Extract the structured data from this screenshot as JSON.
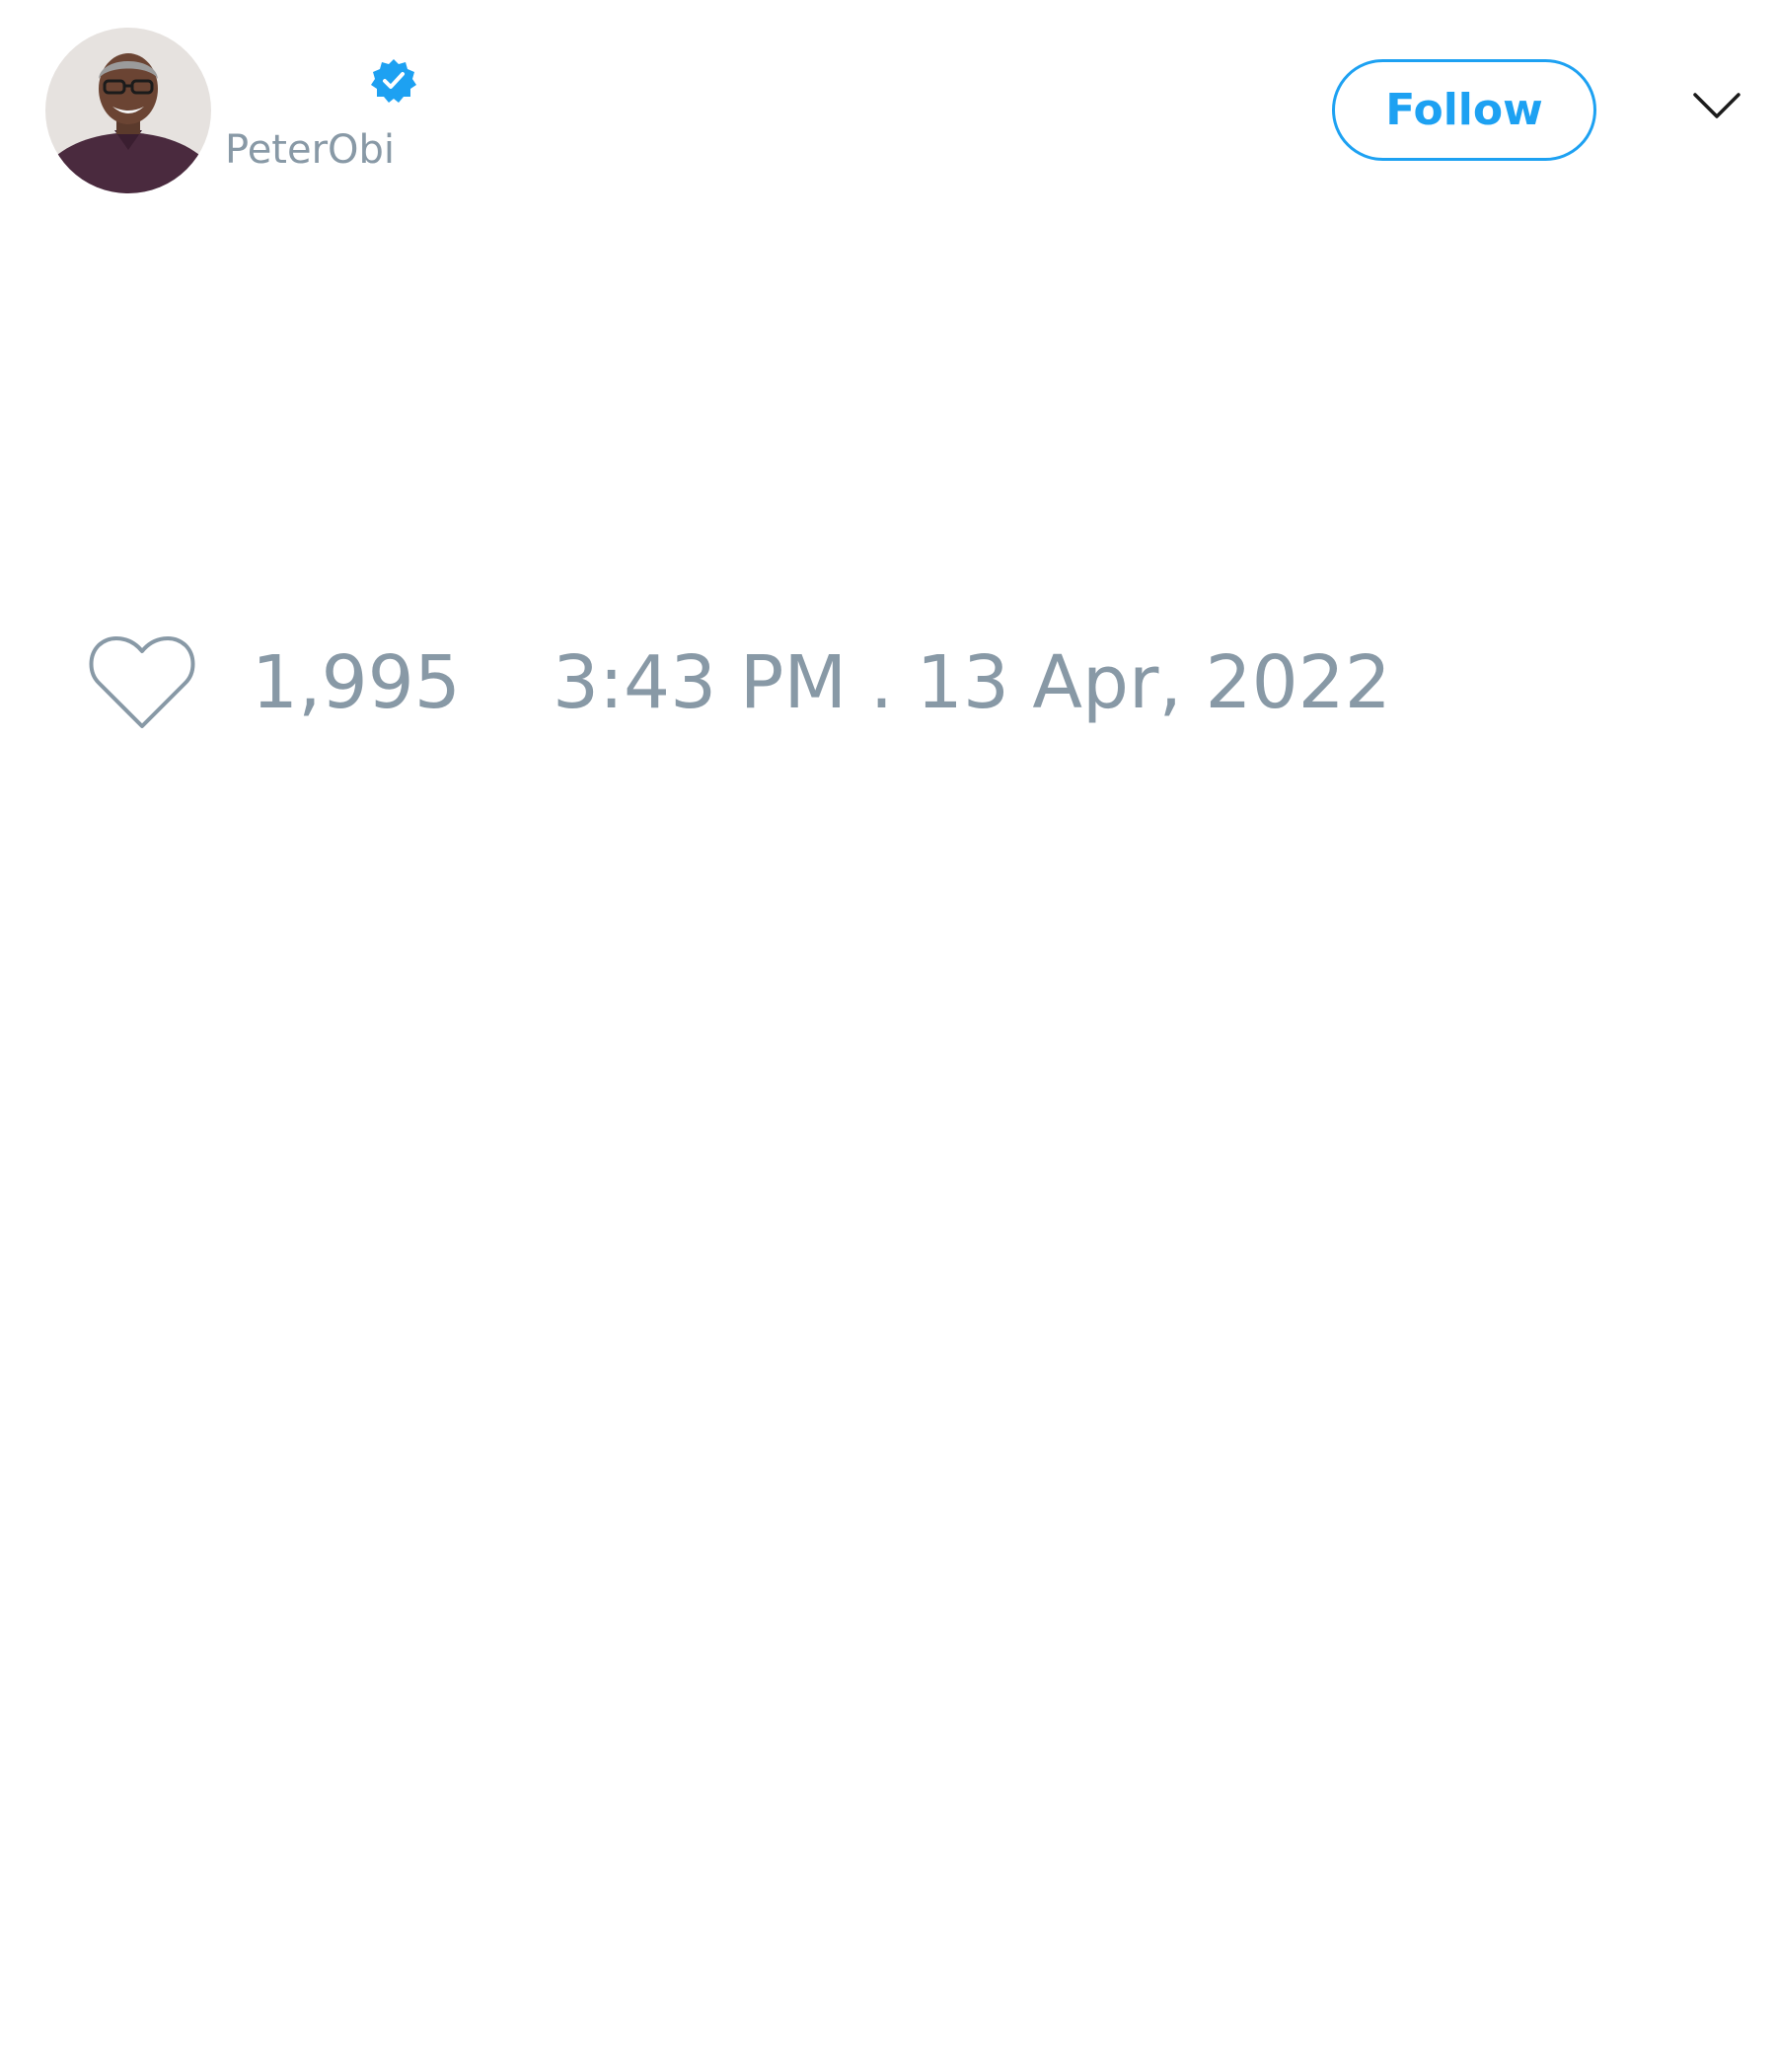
{
  "tweet": {
    "author": {
      "handle": "PeterObi",
      "verified": true
    },
    "follow_label": "Follow",
    "likes": "1,995",
    "timestamp": "3:43 PM . 13 Apr, 2022"
  },
  "icons": {
    "verified": "verified-badge-icon",
    "menu": "chevron-down-icon",
    "like": "heart-icon"
  },
  "colors": {
    "accent": "#1da1f2",
    "muted_text": "#8899a6",
    "background": "#ffffff"
  }
}
